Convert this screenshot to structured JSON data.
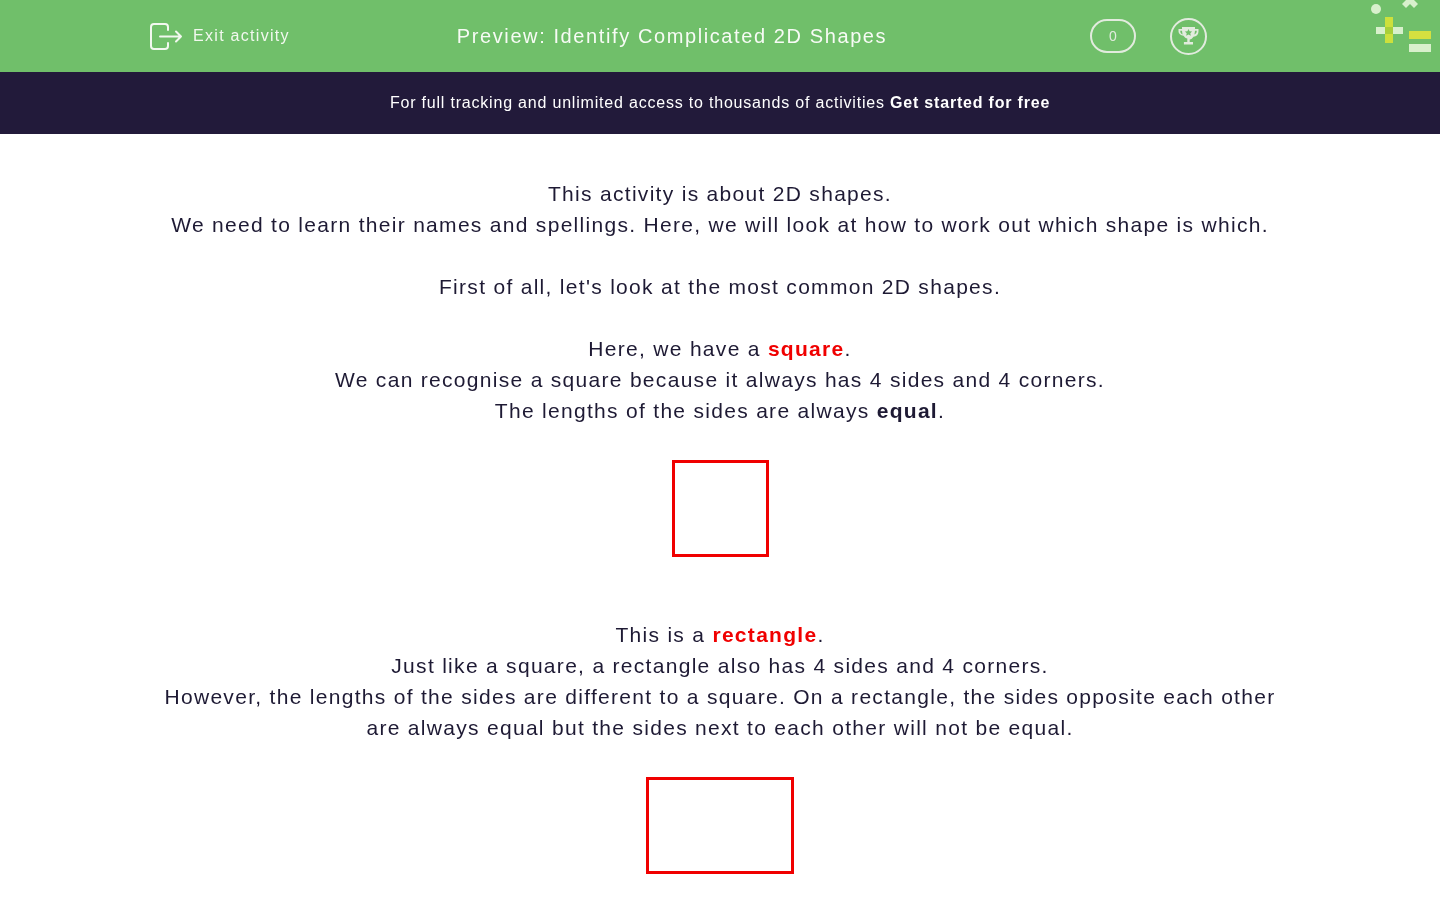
{
  "header": {
    "exit_label": "Exit activity",
    "title": "Preview: Identify Complicated 2D Shapes",
    "score": "0"
  },
  "banner": {
    "text": "For full tracking and unlimited access to thousands of activities",
    "link": "Get started for free"
  },
  "content": [
    {
      "kind": "text",
      "lines": [
        [
          {
            "kind": "plain",
            "text": "This activity is about 2D shapes."
          }
        ],
        [
          {
            "kind": "plain",
            "text": "We need to learn their names and spellings. Here, we will look at how to work out which shape is which."
          }
        ]
      ]
    },
    {
      "kind": "text",
      "lines": [
        [
          {
            "kind": "plain",
            "text": "First of all, let's look at the most common 2D shapes."
          }
        ]
      ]
    },
    {
      "kind": "text",
      "lines": [
        [
          {
            "kind": "plain",
            "text": "Here, we have a "
          },
          {
            "kind": "keyword",
            "text": "square"
          },
          {
            "kind": "plain",
            "text": "."
          }
        ],
        [
          {
            "kind": "plain",
            "text": "We can recognise a square because it always has 4 sides and 4 corners."
          }
        ],
        [
          {
            "kind": "plain",
            "text": "The lengths of the sides are always "
          },
          {
            "kind": "bold",
            "text": "equal"
          },
          {
            "kind": "plain",
            "text": "."
          }
        ]
      ]
    },
    {
      "kind": "square"
    },
    {
      "kind": "text",
      "lines": [
        [
          {
            "kind": "plain",
            "text": "This is a "
          },
          {
            "kind": "keyword",
            "text": "rectangle"
          },
          {
            "kind": "plain",
            "text": "."
          }
        ],
        [
          {
            "kind": "plain",
            "text": "Just like a square, a rectangle also has 4 sides and 4 corners."
          }
        ],
        [
          {
            "kind": "plain",
            "text": "However, the lengths of the sides are different to a square. On a rectangle, the sides opposite each other are always equal but the sides next to each other will not be equal."
          }
        ]
      ]
    },
    {
      "kind": "rectangle"
    }
  ]
}
